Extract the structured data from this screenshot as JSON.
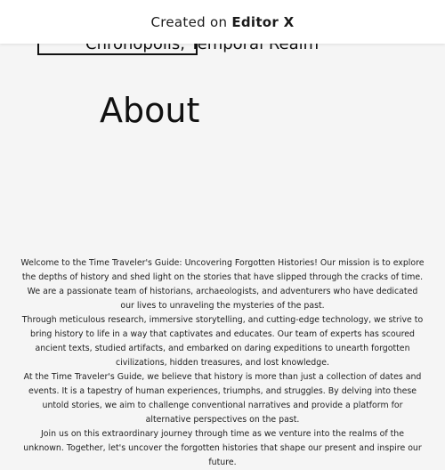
{
  "banner": {
    "prefix": "Created on",
    "brand": "Editor X"
  },
  "header": {
    "location": "Chronopolis, Temporal Realm"
  },
  "about": {
    "title": "About",
    "paragraphs": [
      "Welcome to the Time Traveler's Guide: Uncovering Forgotten Histories! Our mission is to explore the depths of history and shed light on the stories that have slipped through the cracks of time. We are a passionate team of historians, archaeologists, and adventurers who have dedicated our lives to unraveling the mysteries of the past.",
      "Through meticulous research, immersive storytelling, and cutting-edge technology, we strive to bring history to life in a way that captivates and educates. Our team of experts has scoured ancient texts, studied artifacts, and embarked on daring expeditions to unearth forgotten civilizations, hidden treasures, and lost knowledge.",
      "At the Time Traveler's Guide, we believe that history is more than just a collection of dates and events. It is a tapestry of human experiences, triumphs, and struggles. By delving into these untold stories, we aim to challenge conventional narratives and provide a platform for alternative perspectives on the past.",
      "Join us on this extraordinary journey through time as we venture into the realms of the unknown. Together, let's uncover the forgotten histories that shape our present and inspire our future."
    ]
  }
}
